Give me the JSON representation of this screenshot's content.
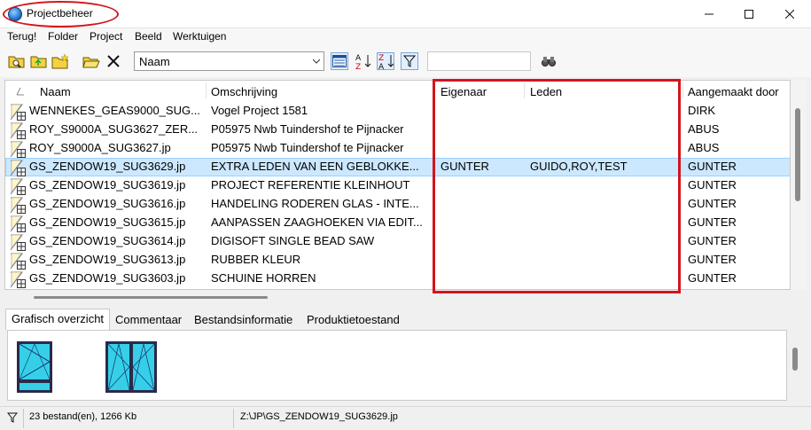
{
  "window": {
    "title": "Projectbeheer"
  },
  "menu": [
    "Terug!",
    "Folder",
    "Project",
    "Beeld",
    "Werktuigen"
  ],
  "toolbar": {
    "sort_value": "Naam",
    "search_value": ""
  },
  "columns": {
    "name": "Naam",
    "description": "Omschrijving",
    "owner": "Eigenaar",
    "members": "Leden",
    "created_by": "Aangemaakt door"
  },
  "rows": [
    {
      "name": "WENNEKES_GEAS9000_SUG...",
      "description": "Vogel Project 1581",
      "owner": "",
      "members": "",
      "created_by": "DIRK"
    },
    {
      "name": "ROY_S9000A_SUG3627_ZER...",
      "description": "P05975 Nwb Tuindershof te Pijnacker",
      "owner": "",
      "members": "",
      "created_by": "ABUS"
    },
    {
      "name": "ROY_S9000A_SUG3627.jp",
      "description": "P05975 Nwb Tuindershof te Pijnacker",
      "owner": "",
      "members": "",
      "created_by": "ABUS"
    },
    {
      "name": "GS_ZENDOW19_SUG3629.jp",
      "description": "EXTRA LEDEN VAN EEN GEBLOKKE...",
      "owner": "GUNTER",
      "members": "GUIDO,ROY,TEST",
      "created_by": "GUNTER"
    },
    {
      "name": "GS_ZENDOW19_SUG3619.jp",
      "description": "PROJECT REFERENTIE KLEINHOUT",
      "owner": "",
      "members": "",
      "created_by": "GUNTER"
    },
    {
      "name": "GS_ZENDOW19_SUG3616.jp",
      "description": "HANDELING RODEREN GLAS - INTE...",
      "owner": "",
      "members": "",
      "created_by": "GUNTER"
    },
    {
      "name": "GS_ZENDOW19_SUG3615.jp",
      "description": "AANPASSEN ZAAGHOEKEN VIA EDIT...",
      "owner": "",
      "members": "",
      "created_by": "GUNTER"
    },
    {
      "name": "GS_ZENDOW19_SUG3614.jp",
      "description": "DIGISOFT SINGLE BEAD SAW",
      "owner": "",
      "members": "",
      "created_by": "GUNTER"
    },
    {
      "name": "GS_ZENDOW19_SUG3613.jp",
      "description": "RUBBER KLEUR",
      "owner": "",
      "members": "",
      "created_by": "GUNTER"
    },
    {
      "name": "GS_ZENDOW19_SUG3603.jp",
      "description": "SCHUINE HORREN",
      "owner": "",
      "members": "",
      "created_by": "GUNTER"
    }
  ],
  "selected_row": 3,
  "tabs": [
    "Grafisch overzicht",
    "Commentaar",
    "Bestandsinformatie",
    "Produktietoestand"
  ],
  "status": {
    "count": "23 bestand(en), 1266 Kb",
    "path": "Z:\\JP\\GS_ZENDOW19_SUG3629.jp"
  },
  "colors": {
    "selection": "#cce8ff",
    "highlight": "#d3141c",
    "glass": "#35d0e8"
  }
}
